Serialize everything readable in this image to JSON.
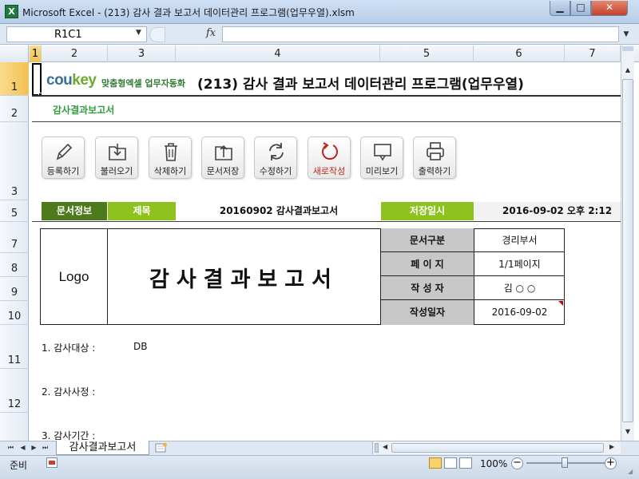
{
  "window": {
    "title": "Microsoft Excel - (213) 감사 결과 보고서 데이터관리 프로그램(업무우열).xlsm",
    "app_icon": "X",
    "minimize": "▁",
    "maximize": "□",
    "close": "✕"
  },
  "formula_bar": {
    "name_box": "R1C1",
    "fx_label": "fx",
    "formula": ""
  },
  "columns": [
    "1",
    "2",
    "3",
    "4",
    "5",
    "6",
    "7"
  ],
  "rows": [
    "1",
    "2",
    "3",
    "5",
    "7",
    "8",
    "9",
    "10",
    "11",
    "12"
  ],
  "header": {
    "brand_co": "cou",
    "brand_key": "key",
    "brand_sub": "맞춤형엑셀 업무자동화",
    "title": "(213) 감사 결과 보고서 데이터관리 프로그램(업무우열)",
    "subtitle": "감사결과보고서"
  },
  "toolbar": {
    "register": "등록하기",
    "load": "불러오기",
    "delete": "삭제하기",
    "save_doc": "문서저장",
    "edit": "수정하기",
    "new": "새로작성",
    "preview": "미리보기",
    "print": "출력하기"
  },
  "info_row": {
    "doc_info": "문서정보",
    "title_label": "제목",
    "title_value": "20160902 감사결과보고서",
    "saved_label": "저장일시",
    "saved_value": "2016-09-02  오후 2:12"
  },
  "doc_header": {
    "logo": "Logo",
    "heading": "감사결과보고서",
    "meta": [
      {
        "label": "문서구분",
        "value": "경리부서"
      },
      {
        "label": "페 이 지",
        "value": "1/1페이지"
      },
      {
        "label": "작 성 자",
        "value": "김 ○ ○"
      },
      {
        "label": "작성일자",
        "value": "2016-09-02"
      }
    ]
  },
  "body": {
    "item1_label": "1. 감사대상 :",
    "item1_value": "DB",
    "item2_label": "2. 감사사정 :",
    "item3_label": "3. 감사기간 :"
  },
  "sheet_tabs": {
    "active": "감사결과보고서"
  },
  "status": {
    "ready": "준비",
    "zoom": "100%"
  }
}
